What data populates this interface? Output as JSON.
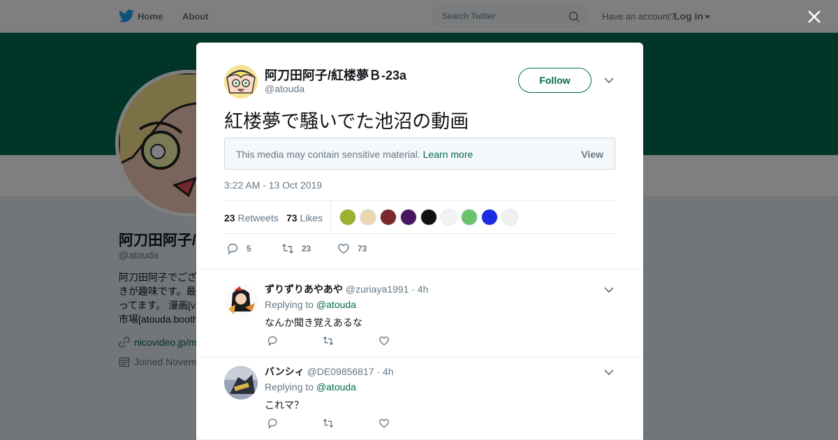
{
  "nav": {
    "home": "Home",
    "about": "About",
    "search_placeholder": "Search Twitter",
    "have_account": "Have an account?",
    "login": "Log in"
  },
  "profile": {
    "name": "阿刀田阿子/",
    "handle": "@atouda",
    "bio_visible": "阿刀田阿子でござ\nきが趣味です。最\nってます。 漫画[v\n市場[atouda.booth",
    "link": "nicovideo.jp/m",
    "joined": "Joined Novem"
  },
  "tweet": {
    "author_name": "阿刀田阿子/紅楼夢Ｂ-23a",
    "author_handle": "@atouda",
    "follow_label": "Follow",
    "text": "紅楼夢で騒いでた池沼の動画",
    "sensitive_message": "This media may contain sensitive material.",
    "learn_more": "Learn more",
    "view_label": "View",
    "timestamp": "3:22 AM - 13 Oct 2019",
    "retweets_count": "23",
    "retweets_label": "Retweets",
    "likes_count": "73",
    "likes_label": "Likes",
    "reply_count": "5",
    "retweet_action_count": "23",
    "like_action_count": "73"
  },
  "likers": [
    {
      "color": "#9bb02f"
    },
    {
      "color": "#e9d7b4"
    },
    {
      "color": "#7a2a2a"
    },
    {
      "color": "#4a1560"
    },
    {
      "color": "#111111"
    },
    {
      "color": "#f3f3f3"
    },
    {
      "color": "#6cc26c"
    },
    {
      "color": "#1a2be0"
    },
    {
      "color": "#f0f0f0"
    }
  ],
  "replies": [
    {
      "name": "ずりずりあやあや",
      "handle": "@zuriaya1991",
      "time": "· 4h",
      "replying_label": "Replying to",
      "replying_to": "@atouda",
      "text": "なんか聞き覚えあるな"
    },
    {
      "name": "バンシィ",
      "handle": "@DE09856817",
      "time": "· 4h",
      "replying_label": "Replying to",
      "replying_to": "@atouda",
      "text": "これマ？"
    }
  ],
  "colors": {
    "brand": "#006a4e",
    "twitter_blue": "#1da1f2"
  }
}
